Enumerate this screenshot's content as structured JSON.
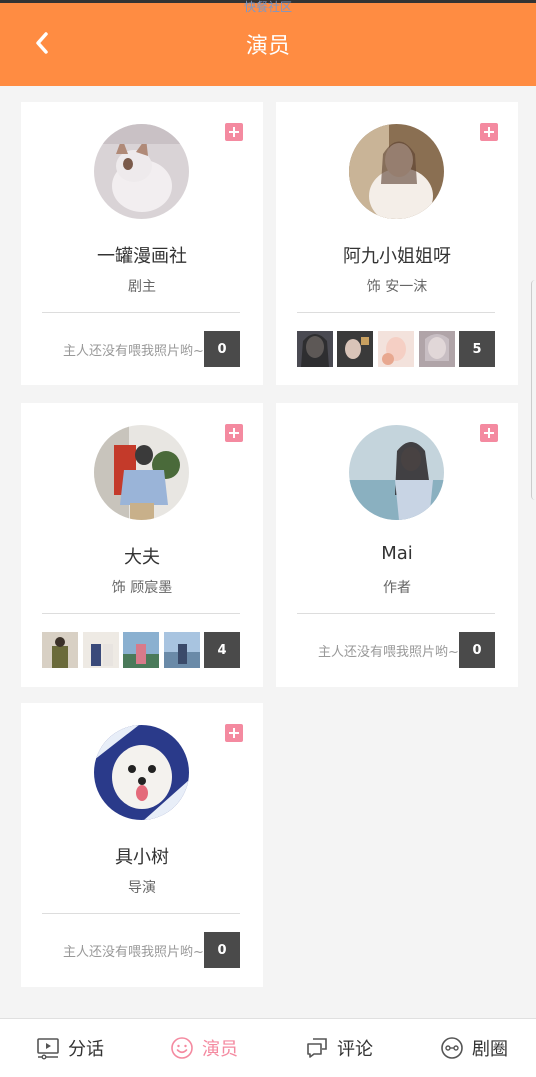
{
  "header": {
    "status_text": "快餐社区",
    "title": "演员"
  },
  "cards": [
    {
      "name": "一罐漫画社",
      "role": "剧主",
      "empty_text": "主人还没有喂我照片哟~",
      "count": "0"
    },
    {
      "name": "阿九小姐姐呀",
      "role": "饰 安一沫",
      "count": "5"
    },
    {
      "name": "大夫",
      "role": "饰 顾宸墨",
      "count": "4"
    },
    {
      "name": "Mai",
      "role": "作者",
      "empty_text": "主人还没有喂我照片哟~",
      "count": "0"
    },
    {
      "name": "具小树",
      "role": "导演",
      "empty_text": "主人还没有喂我照片哟~",
      "count": "0"
    }
  ],
  "tabs": [
    {
      "label": "分话",
      "icon": "video-list-icon"
    },
    {
      "label": "演员",
      "icon": "smiley-icon",
      "active": true
    },
    {
      "label": "评论",
      "icon": "comment-icon"
    },
    {
      "label": "剧圈",
      "icon": "circle-face-icon"
    }
  ],
  "colors": {
    "accent": "#ff8c42",
    "pink": "#f48aa0",
    "count_box": "#4a4a4a"
  }
}
